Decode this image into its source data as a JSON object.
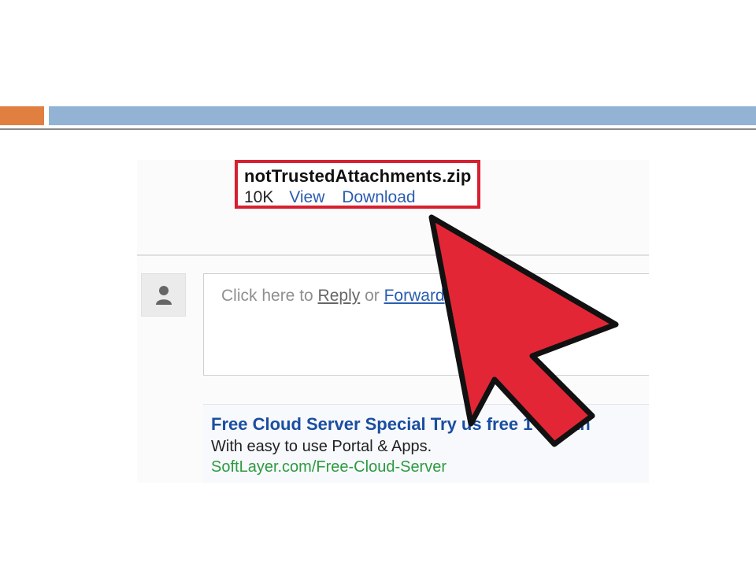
{
  "attachment": {
    "filename": "notTrustedAttachments.zip",
    "size": "10K",
    "view_label": "View",
    "download_label": "Download"
  },
  "reply": {
    "prefix": "Click here to ",
    "reply_label": "Reply",
    "or_text": " or ",
    "forward_label": "Forward"
  },
  "ad": {
    "title": "Free Cloud Server Special Try us free 1 month",
    "description": "With easy to use Portal & Apps.",
    "url": "SoftLayer.com/Free-Cloud-Server"
  },
  "colors": {
    "highlight_red": "#d6202f",
    "arrow_red": "#e32636",
    "link_blue": "#2a5db0",
    "ad_url_green": "#2e9a40",
    "slide_orange": "#e07f3f",
    "slide_blue": "#92b3d4"
  },
  "icons": {
    "avatar": "person-icon",
    "pointer": "red-arrow-cursor"
  }
}
